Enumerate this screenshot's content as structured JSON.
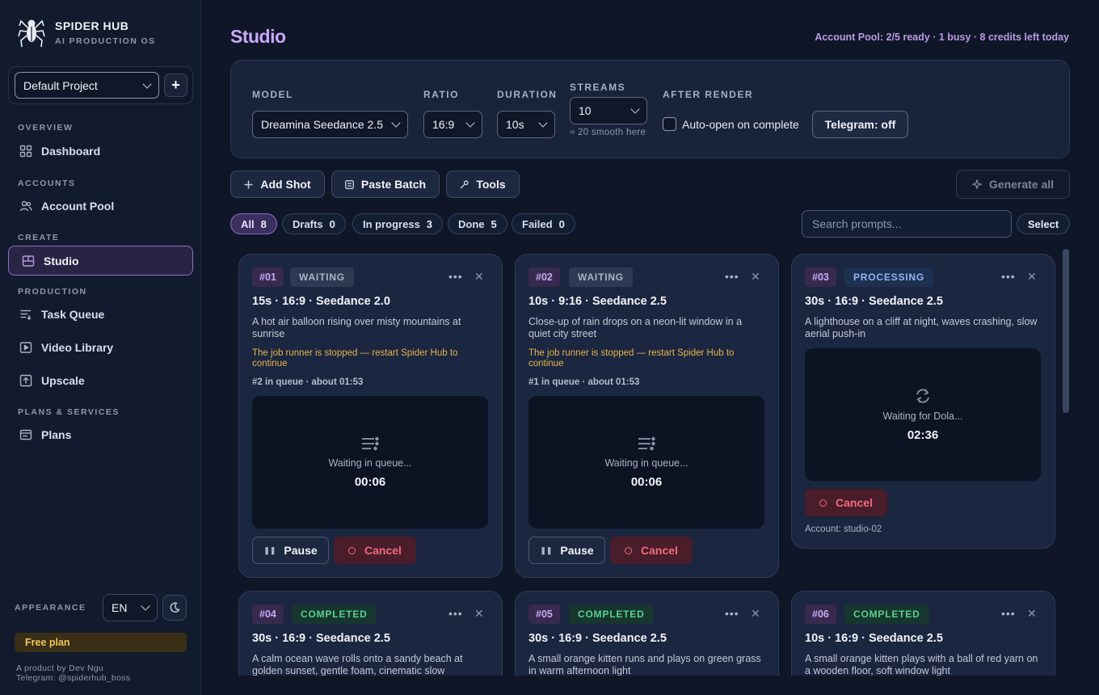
{
  "brand": {
    "name": "SPIDER HUB",
    "subtitle": "AI PRODUCTION OS",
    "logo": "spider-logo"
  },
  "project": {
    "selected": "Default Project",
    "add_label": "+"
  },
  "nav": {
    "overview_section": "OVERVIEW",
    "dashboard": "Dashboard",
    "accounts_section": "ACCOUNTS",
    "account_pool": "Account Pool",
    "create_section": "CREATE",
    "studio": "Studio",
    "production_section": "PRODUCTION",
    "task_queue": "Task Queue",
    "video_library": "Video Library",
    "upscale": "Upscale",
    "plans_section": "PLANS & SERVICES",
    "plans": "Plans",
    "active": "Studio"
  },
  "appearance": {
    "label": "APPEARANCE",
    "language": "EN",
    "theme_icon": "moon-icon"
  },
  "plan_badge": "Free plan",
  "footer": {
    "line1": "A product by Dev Ngu",
    "line2": "Telegram: @spiderhub_boss"
  },
  "header": {
    "title": "Studio",
    "pool_status": "Account Pool: 2/5 ready · 1 busy · 8 credits left today"
  },
  "settings": {
    "model_label": "MODEL",
    "model_value": "Dreamina Seedance 2.5",
    "ratio_label": "RATIO",
    "ratio_value": "16:9",
    "duration_label": "DURATION",
    "duration_value": "10s",
    "streams_label": "STREAMS",
    "streams_value": "10",
    "streams_hint": "≈ 20 smooth here",
    "after_label": "AFTER RENDER",
    "auto_open_label": "Auto-open on complete",
    "auto_open_checked": false,
    "telegram_label": "Telegram: off"
  },
  "toolbar": {
    "add_shot": "Add Shot",
    "paste_batch": "Paste Batch",
    "tools": "Tools",
    "generate_all": "Generate all"
  },
  "filters": {
    "all_label": "All",
    "all_count": "8",
    "drafts_label": "Drafts",
    "drafts_count": "0",
    "inprogress_label": "In progress",
    "inprogress_count": "3",
    "done_label": "Done",
    "done_count": "5",
    "failed_label": "Failed",
    "failed_count": "0",
    "active": "All"
  },
  "search": {
    "placeholder": "Search prompts..."
  },
  "select_label": "Select",
  "cards": [
    {
      "id": "#01",
      "status": "WAITING",
      "title": "15s · 16:9 · Seedance 2.0",
      "prompt": "A hot air balloon rising over misty mountains at sunrise",
      "warning": "The job runner is stopped — restart Spider Hub to continue",
      "queue": "#2 in queue · about 01:53",
      "preview_label": "Waiting in queue...",
      "preview_time": "00:06",
      "pause": "Pause",
      "cancel": "Cancel"
    },
    {
      "id": "#02",
      "status": "WAITING",
      "title": "10s · 9:16 · Seedance 2.5",
      "prompt": "Close-up of rain drops on a neon-lit window in a quiet city street",
      "warning": "The job runner is stopped — restart Spider Hub to continue",
      "queue": "#1 in queue · about 01:53",
      "preview_label": "Waiting in queue...",
      "preview_time": "00:06",
      "pause": "Pause",
      "cancel": "Cancel"
    },
    {
      "id": "#03",
      "status": "PROCESSING",
      "title": "30s · 16:9 · Seedance 2.5",
      "prompt": "A lighthouse on a cliff at night, waves crashing, slow aerial push-in",
      "preview_label": "Waiting for Dola...",
      "preview_time": "02:36",
      "cancel": "Cancel",
      "account": "Account: studio-02"
    },
    {
      "id": "#04",
      "status": "COMPLETED",
      "title": "30s · 16:9 · Seedance 2.5",
      "prompt": "A calm ocean wave rolls onto a sandy beach at golden sunset, gentle foam, cinematic slow"
    },
    {
      "id": "#05",
      "status": "COMPLETED",
      "title": "30s · 16:9 · Seedance 2.5",
      "prompt": "A small orange kitten runs and plays on green grass in warm afternoon light"
    },
    {
      "id": "#06",
      "status": "COMPLETED",
      "title": "10s · 16:9 · Seedance 2.5",
      "prompt": "A small orange kitten plays with a ball of red yarn on a wooden floor, soft window light"
    }
  ],
  "colors": {
    "accent": "#c9a8f5",
    "warning": "#e6b54a",
    "completed": "#5ad08c",
    "processing": "#8fb5f0",
    "danger": "#ef6b7d"
  }
}
